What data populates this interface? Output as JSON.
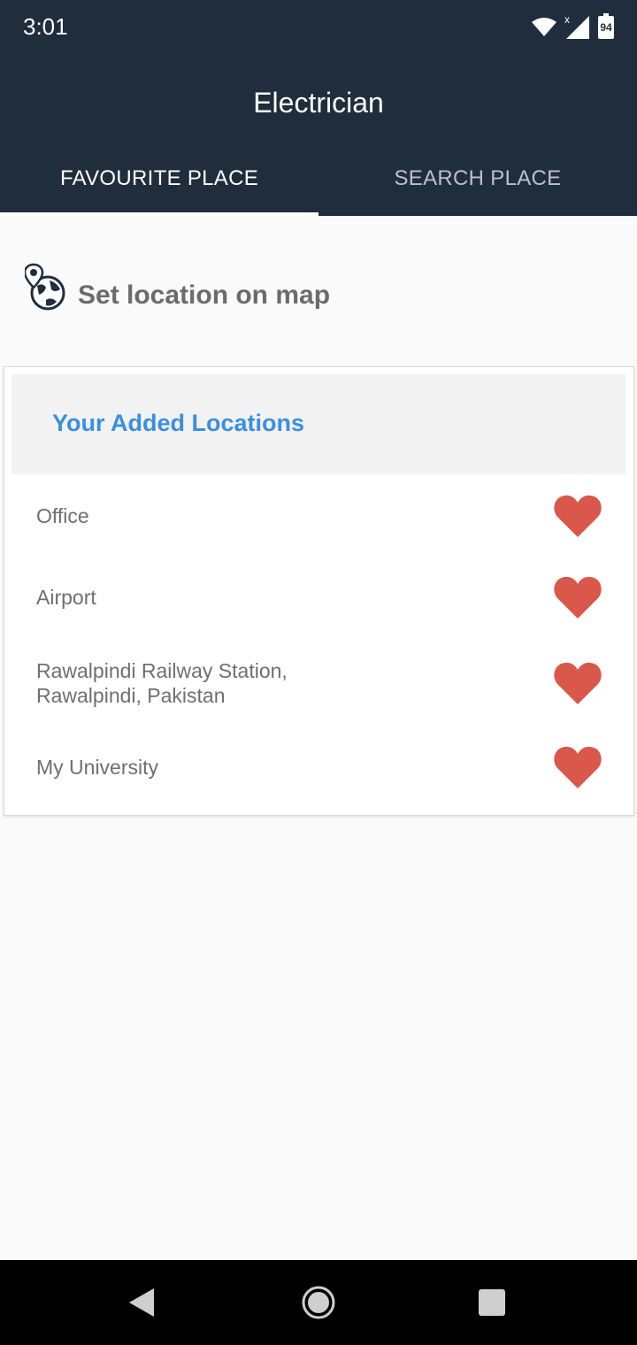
{
  "status_bar": {
    "time": "3:01",
    "battery_level": "94",
    "icons": [
      "wifi-icon",
      "signal-icon",
      "battery-icon"
    ]
  },
  "toolbar": {
    "title": "Electrician",
    "tabs": [
      {
        "label": "FAVOURITE PLACE",
        "active": true
      },
      {
        "label": "SEARCH PLACE",
        "active": false
      }
    ]
  },
  "set_location": {
    "label": "Set location on map",
    "icon": "map-globe-pin-icon"
  },
  "locations_card": {
    "header": "Your Added Locations",
    "items": [
      {
        "label": "Office",
        "favourite": true
      },
      {
        "label": "Airport",
        "favourite": true
      },
      {
        "label": "Rawalpindi Railway Station,\nRawalpindi, Pakistan",
        "favourite": true
      },
      {
        "label": "My University",
        "favourite": true
      }
    ]
  },
  "colors": {
    "primary_dark": "#1f2d3d",
    "accent_blue": "#3b8fe0",
    "heart_red": "#d9584b"
  },
  "nav_bar": {
    "buttons": [
      "back-icon",
      "home-icon",
      "recents-icon"
    ]
  }
}
